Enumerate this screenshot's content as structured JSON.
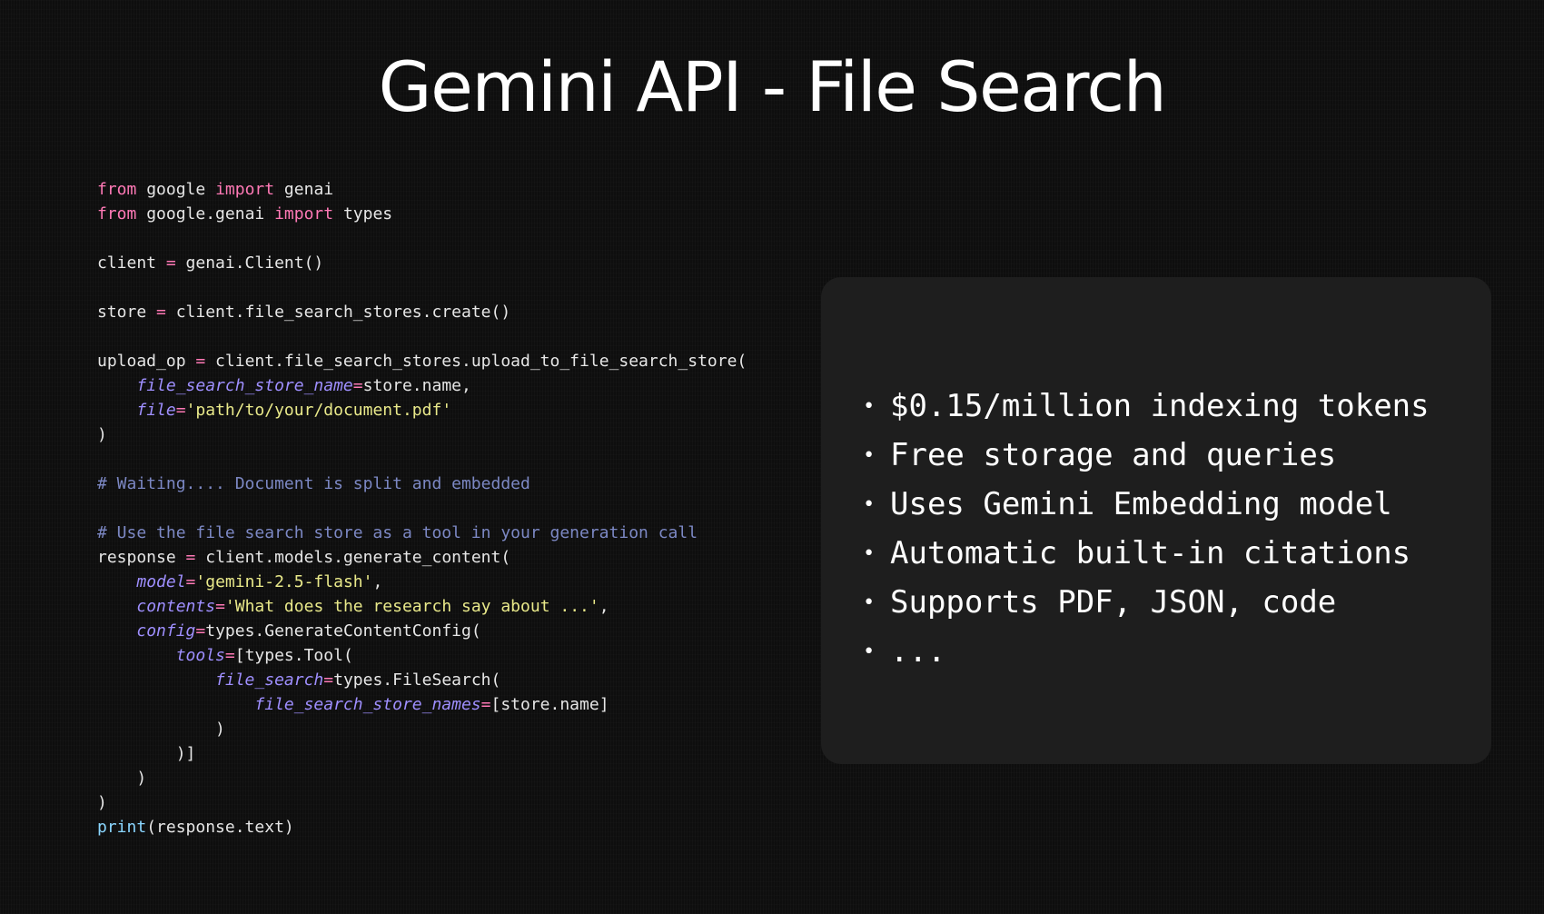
{
  "slide": {
    "title": "Gemini API - File Search"
  },
  "code": {
    "lines": [
      [
        {
          "t": "from",
          "c": "kw"
        },
        {
          "t": " google ",
          "c": "txt"
        },
        {
          "t": "import",
          "c": "kw"
        },
        {
          "t": " genai",
          "c": "txt"
        }
      ],
      [
        {
          "t": "from",
          "c": "kw"
        },
        {
          "t": " google.genai ",
          "c": "txt"
        },
        {
          "t": "import",
          "c": "kw"
        },
        {
          "t": " types",
          "c": "txt"
        }
      ],
      [],
      [
        {
          "t": "client ",
          "c": "txt"
        },
        {
          "t": "=",
          "c": "op"
        },
        {
          "t": " genai.Client()",
          "c": "txt"
        }
      ],
      [],
      [
        {
          "t": "store ",
          "c": "txt"
        },
        {
          "t": "=",
          "c": "op"
        },
        {
          "t": " client.file_search_stores.create()",
          "c": "txt"
        }
      ],
      [],
      [
        {
          "t": "upload_op ",
          "c": "txt"
        },
        {
          "t": "=",
          "c": "op"
        },
        {
          "t": " client.file_search_stores.upload_to_file_search_store(",
          "c": "txt"
        }
      ],
      [
        {
          "t": "    ",
          "c": "txt"
        },
        {
          "t": "file_search_store_name",
          "c": "arg"
        },
        {
          "t": "=",
          "c": "op"
        },
        {
          "t": "store.name,",
          "c": "txt"
        }
      ],
      [
        {
          "t": "    ",
          "c": "txt"
        },
        {
          "t": "file",
          "c": "arg"
        },
        {
          "t": "=",
          "c": "op"
        },
        {
          "t": "'path/to/your/document.pdf'",
          "c": "str"
        }
      ],
      [
        {
          "t": ")",
          "c": "txt"
        }
      ],
      [],
      [
        {
          "t": "# Waiting.... Document is split and embedded",
          "c": "cm"
        }
      ],
      [],
      [
        {
          "t": "# Use the file search store as a tool in your generation call",
          "c": "cm"
        }
      ],
      [
        {
          "t": "response ",
          "c": "txt"
        },
        {
          "t": "=",
          "c": "op"
        },
        {
          "t": " client.models.generate_content(",
          "c": "txt"
        }
      ],
      [
        {
          "t": "    ",
          "c": "txt"
        },
        {
          "t": "model",
          "c": "arg"
        },
        {
          "t": "=",
          "c": "op"
        },
        {
          "t": "'gemini-2.5-flash'",
          "c": "str"
        },
        {
          "t": ",",
          "c": "txt"
        }
      ],
      [
        {
          "t": "    ",
          "c": "txt"
        },
        {
          "t": "contents",
          "c": "arg"
        },
        {
          "t": "=",
          "c": "op"
        },
        {
          "t": "'What does the research say about ...'",
          "c": "str"
        },
        {
          "t": ",",
          "c": "txt"
        }
      ],
      [
        {
          "t": "    ",
          "c": "txt"
        },
        {
          "t": "config",
          "c": "arg"
        },
        {
          "t": "=",
          "c": "op"
        },
        {
          "t": "types.GenerateContentConfig(",
          "c": "txt"
        }
      ],
      [
        {
          "t": "        ",
          "c": "txt"
        },
        {
          "t": "tools",
          "c": "arg"
        },
        {
          "t": "=",
          "c": "op"
        },
        {
          "t": "[types.Tool(",
          "c": "txt"
        }
      ],
      [
        {
          "t": "            ",
          "c": "txt"
        },
        {
          "t": "file_search",
          "c": "arg"
        },
        {
          "t": "=",
          "c": "op"
        },
        {
          "t": "types.FileSearch(",
          "c": "txt"
        }
      ],
      [
        {
          "t": "                ",
          "c": "txt"
        },
        {
          "t": "file_search_store_names",
          "c": "arg"
        },
        {
          "t": "=",
          "c": "op"
        },
        {
          "t": "[store.name]",
          "c": "txt"
        }
      ],
      [
        {
          "t": "            )",
          "c": "txt"
        }
      ],
      [
        {
          "t": "        )]",
          "c": "txt"
        }
      ],
      [
        {
          "t": "    )",
          "c": "txt"
        }
      ],
      [
        {
          "t": ")",
          "c": "txt"
        }
      ],
      [
        {
          "t": "print",
          "c": "fn"
        },
        {
          "t": "(response.text)",
          "c": "txt"
        }
      ]
    ]
  },
  "features": {
    "bullet_glyph": "•",
    "items": [
      "$0.15/million indexing tokens",
      "Free storage and queries",
      "Uses Gemini Embedding model",
      "Automatic built-in citations",
      "Supports PDF, JSON, code",
      "..."
    ]
  },
  "colors": {
    "background": "#0e0e0e",
    "panel": "#1e1e1e",
    "keyword": "#ff79b6",
    "argument": "#9f8fff",
    "string": "#e9e98a",
    "comment": "#7c88c4",
    "builtin": "#8ad6ff",
    "text": "#e6e6e6"
  }
}
